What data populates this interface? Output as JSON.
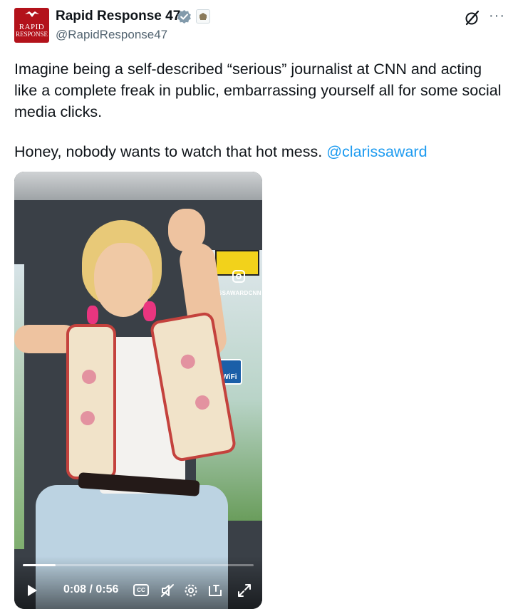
{
  "tweet": {
    "display_name": "Rapid Response 47",
    "handle": "@RapidResponse47",
    "avatar_text_line1": "RAPID",
    "avatar_text_line2": "RESPONSE",
    "body_line1": "Imagine being a self-described “serious” journalist at CNN and acting like a complete freak in public, embarrassing yourself all for some social media clicks.",
    "body_line2_prefix": "Honey, nobody wants to watch that hot mess.",
    "mention": "@clarissaward",
    "more_label": "···"
  },
  "video": {
    "watermark": "@CLARISSAWARDCNN",
    "wifi_label": "WiFi",
    "time_display": "0:08 / 0:56",
    "cc_label": "CC",
    "progress": 0.143,
    "icons": [
      "play-icon",
      "closed-captions-icon",
      "mute-icon",
      "settings-icon",
      "dock-icon",
      "fullscreen-icon"
    ]
  },
  "colors": {
    "link": "#1d9bf0",
    "verified": "#829aab",
    "avatar_bg": "#b3121b",
    "secondary_text": "#536471"
  }
}
